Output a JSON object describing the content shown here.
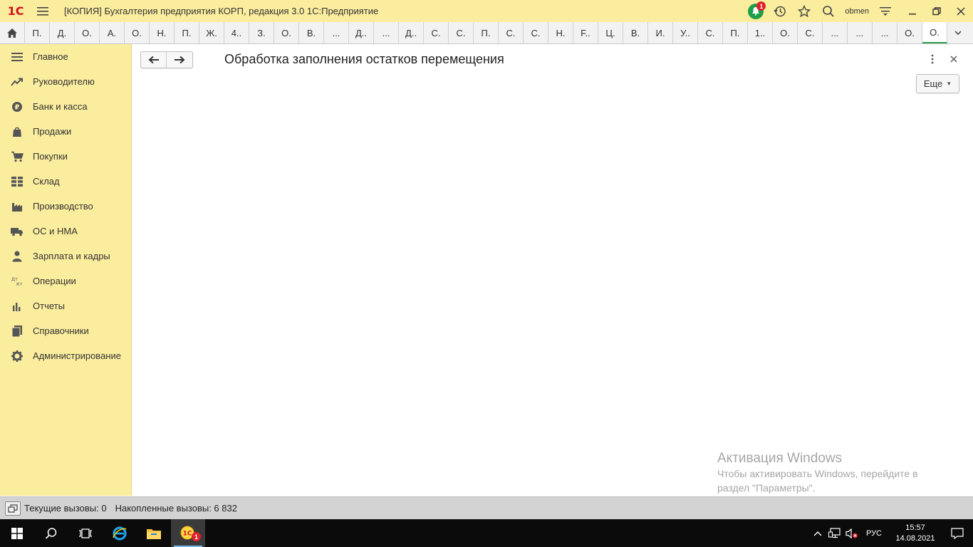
{
  "titlebar": {
    "logo": "1С",
    "title": "[КОПИЯ] Бухгалтерия предприятия КОРП, редакция 3.0 1С:Предприятие",
    "notification_count": "1",
    "user": "obmen"
  },
  "tabs": [
    "П.",
    "Д.",
    "О.",
    "А.",
    "О.",
    "Н.",
    "П.",
    "Ж.",
    "4..",
    "З.",
    "О.",
    "В.",
    "...",
    "Д..",
    "...",
    "Д..",
    "С.",
    "С.",
    "П.",
    "С.",
    "С.",
    "Н.",
    "F..",
    "Ц.",
    "В.",
    "И.",
    "У..",
    "С.",
    "П.",
    "1..",
    "О.",
    "С.",
    "...",
    "...",
    "...",
    "О.",
    "О."
  ],
  "sidebar": {
    "items": [
      {
        "label": "Главное",
        "icon": "menu-lines-icon"
      },
      {
        "label": "Руководителю",
        "icon": "trend-icon"
      },
      {
        "label": "Банк и касса",
        "icon": "ruble-coin-icon"
      },
      {
        "label": "Продажи",
        "icon": "shopping-bag-icon"
      },
      {
        "label": "Покупки",
        "icon": "cart-icon"
      },
      {
        "label": "Склад",
        "icon": "warehouse-grid-icon"
      },
      {
        "label": "Производство",
        "icon": "factory-icon"
      },
      {
        "label": "ОС и НМА",
        "icon": "truck-icon"
      },
      {
        "label": "Зарплата и кадры",
        "icon": "person-icon"
      },
      {
        "label": "Операции",
        "icon": "debit-credit-icon"
      },
      {
        "label": "Отчеты",
        "icon": "bar-chart-icon"
      },
      {
        "label": "Справочники",
        "icon": "books-icon"
      },
      {
        "label": "Администрирование",
        "icon": "gear-icon"
      }
    ]
  },
  "form": {
    "title": "Обработка заполнения остатков перемещения",
    "more_label": "Еще"
  },
  "watermark": {
    "title": "Активация Windows",
    "line1": "Чтобы активировать Windows, перейдите в",
    "line2": "раздел \"Параметры\"."
  },
  "statusbar": {
    "current_calls": "Текущие вызовы: 0",
    "accumulated_calls": "Накопленные вызовы: 6 832"
  },
  "taskbar": {
    "lang": "РУС",
    "time": "15:57",
    "date": "14.08.2021",
    "app_badge": "1"
  },
  "colors": {
    "panel_yellow": "#fbed9e",
    "active_tab_underline": "#2f9a4a",
    "notification_green": "#1e9e49",
    "badge_red": "#e0202a"
  }
}
